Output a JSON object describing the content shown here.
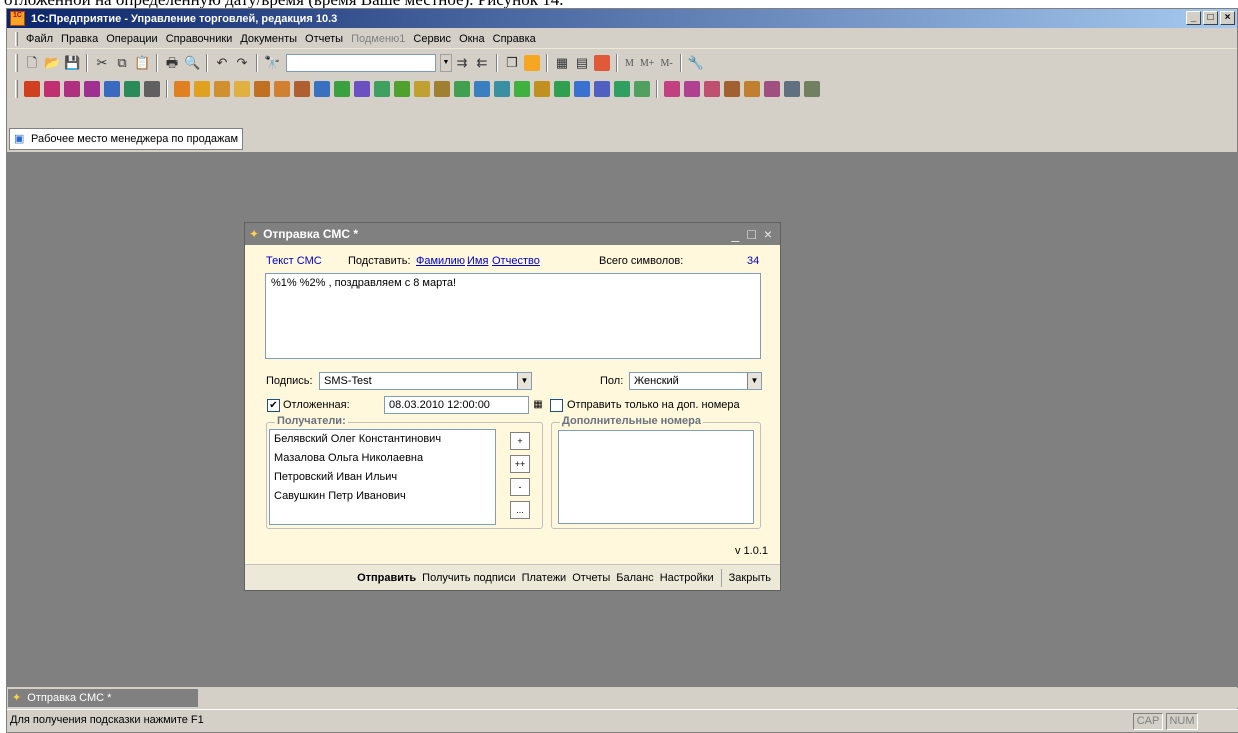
{
  "document_text": "отложенной на определенную дату/время (время Ваше местное). Рисунок 14.",
  "app": {
    "title": "1С:Предприятие - Управление торговлей, редакция 10.3",
    "logo_text": "1С"
  },
  "menu": [
    "Файл",
    "Правка",
    "Операции",
    "Справочники",
    "Документы",
    "Отчеты",
    "Подменю1",
    "Сервис",
    "Окна",
    "Справка"
  ],
  "toolbar2": {
    "m1": "M",
    "m2": "M+",
    "m3": "M-"
  },
  "panel_tab": "Рабочее место менеджера по продажам",
  "dialog": {
    "title": "Отправка СМС *",
    "text_label": "Текст СМС",
    "insert_label": "Подставить:",
    "insert_surname": "Фамилию",
    "insert_name": "Имя",
    "insert_patronymic": "Отчество",
    "total_label": "Всего символов:",
    "total_count": "34",
    "message": "%1% %2% , поздравляем с 8 марта!",
    "signature_label": "Подпись:",
    "signature_value": "SMS-Test",
    "gender_label": "Пол:",
    "gender_value": "Женский",
    "delayed_label": "Отложенная:",
    "delayed_checked": true,
    "delayed_datetime": "08.03.2010 12:00:00",
    "only_extra_label": "Отправить только на доп. номера",
    "only_extra_checked": false,
    "recipients_title": "Получатели:",
    "recipients": [
      "Белявский Олег Константинович",
      "Мазалова Ольга Николаевна",
      "Петровский Иван Ильич",
      "Савушкин Петр Иванович"
    ],
    "recipient_buttons": [
      "+",
      "++",
      "-",
      "..."
    ],
    "extra_numbers_title": "Дополнительные номера",
    "version": "v 1.0.1",
    "footer": {
      "send": "Отправить",
      "get_signatures": "Получить подписи",
      "payments": "Платежи",
      "reports": "Отчеты",
      "balance": "Баланс",
      "settings": "Настройки",
      "close": "Закрыть"
    }
  },
  "taskbar_tab": "Отправка СМС *",
  "status": {
    "hint": "Для получения подсказки нажмите F1",
    "cap": "CAP",
    "num": "NUM"
  }
}
